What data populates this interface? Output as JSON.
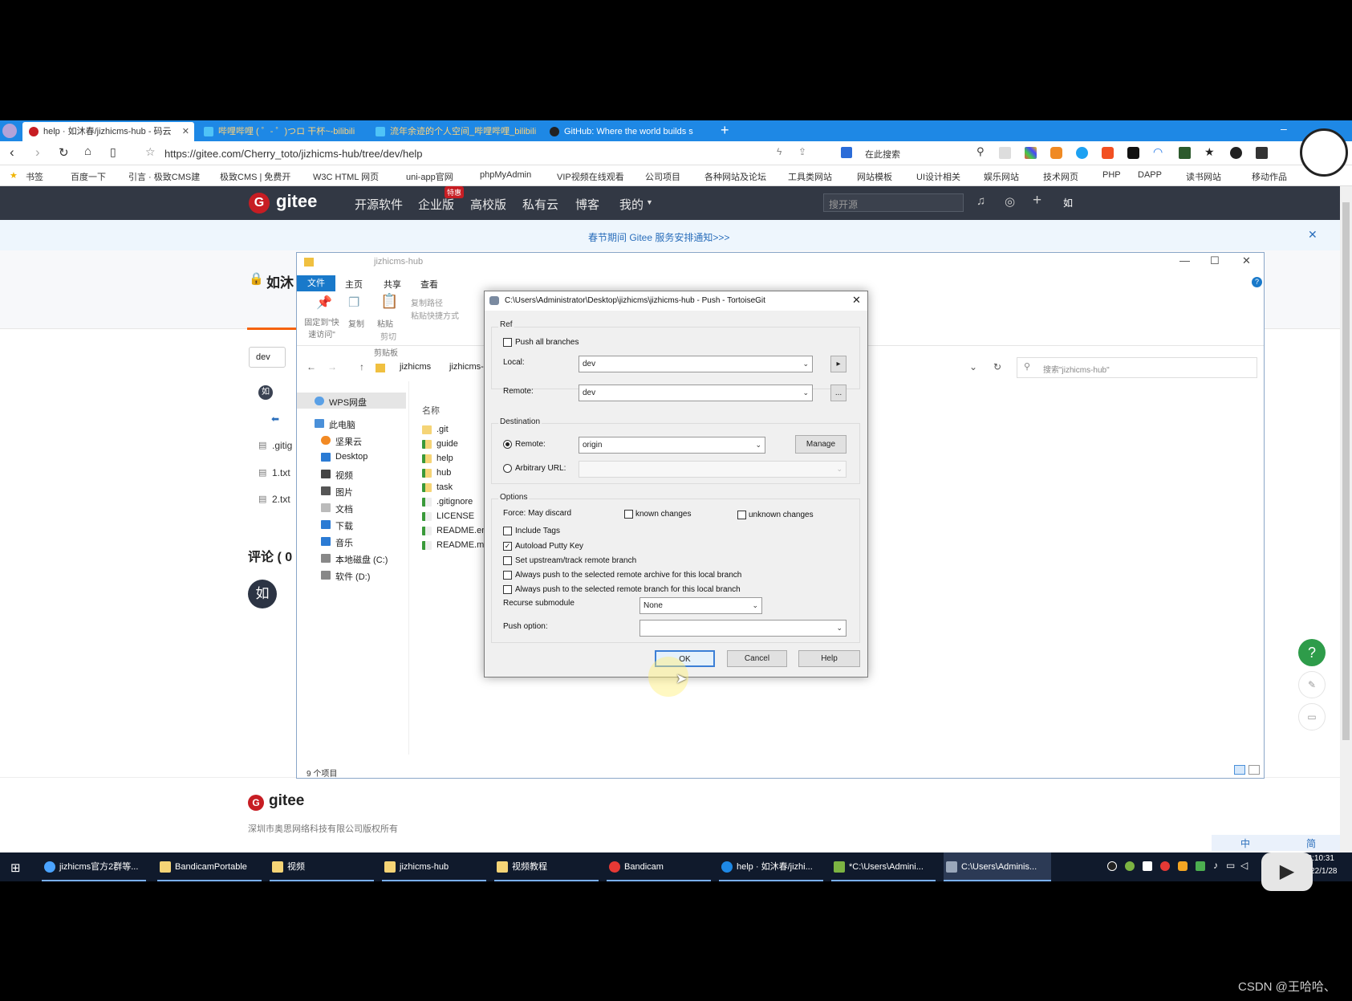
{
  "browser": {
    "tabs": [
      {
        "label": "help · 如沐春/jizhicms-hub - 码云",
        "active": true
      },
      {
        "label": "哔哩哔哩 ( ゜- ゜)つロ 干杯~-bilibili",
        "active": false
      },
      {
        "label": "流年余迹的个人空间_哔哩哔哩_bilibili",
        "active": false
      },
      {
        "label": "GitHub: Where the world builds s",
        "active": false
      }
    ],
    "url": "https://gitee.com/Cherry_toto/jizhicms-hub/tree/dev/help",
    "search_placeholder": "在此搜索",
    "bookmarks": [
      "书签",
      "百度一下",
      "引言 · 极致CMS建",
      "极致CMS | 免费开",
      "W3C HTML 网页",
      "uni-app官网",
      "phpMyAdmin",
      "VIP视频在线观看",
      "公司项目",
      "各种网站及论坛",
      "工具类网站",
      "网站模板",
      "UI设计相关",
      "娱乐网站",
      "技术网页",
      "PHP",
      "DAPP",
      "读书网站",
      "移动作品"
    ]
  },
  "gitee": {
    "logo": "gitee",
    "nav": [
      "开源软件",
      "企业版",
      "高校版",
      "私有云",
      "博客",
      "我的"
    ],
    "enterprise_badge": "特惠",
    "search_placeholder": "搜开源",
    "notice": "春节期间 Gitee 服务安排通知>>>",
    "repo_title": "如沐",
    "branch": "dev",
    "files": [
      ".gitig",
      "1.txt",
      "2.txt"
    ],
    "comments_label": "评论 ( 0",
    "avatar_text": "如",
    "footer_logo": "gitee",
    "footer_text": "深圳市奥思网络科技有限公司版权所有"
  },
  "explorer": {
    "title": "jizhicms-hub",
    "ribbon_tabs": [
      "文件",
      "主页",
      "共享",
      "查看"
    ],
    "ribbon_buttons": [
      "固定到\"快速访问\"",
      "复制",
      "粘贴",
      "复制路径",
      "粘贴快捷方式",
      "剪切",
      "剪贴板"
    ],
    "breadcrumb": [
      "jizhicms",
      "jizhicms-"
    ],
    "search_placeholder": "搜索\"jizhicms-hub\"",
    "nav_items": [
      "WPS网盘",
      "此电脑",
      "坚果云",
      "Desktop",
      "视频",
      "图片",
      "文档",
      "下载",
      "音乐",
      "本地磁盘 (C:)",
      "软件 (D:)"
    ],
    "column_header": "名称",
    "files": [
      ".git",
      "guide",
      "help",
      "hub",
      "task",
      ".gitignore",
      "LICENSE",
      "README.en",
      "README.md"
    ],
    "status": "9 个项目"
  },
  "dialog": {
    "title": "C:\\Users\\Administrator\\Desktop\\jizhicms\\jizhicms-hub - Push - TortoiseGit",
    "ref_group": "Ref",
    "push_all_branches": "Push all branches",
    "local_label": "Local:",
    "local_value": "dev",
    "remote_label": "Remote:",
    "remote_value": "dev",
    "remote_browse": "...",
    "destination_group": "Destination",
    "dest_remote_label": "Remote:",
    "dest_remote_value": "origin",
    "manage_label": "Manage",
    "arbitrary_url_label": "Arbitrary URL:",
    "options_group": "Options",
    "force_label": "Force: May discard",
    "known_changes": "known changes",
    "unknown_changes": "unknown changes",
    "include_tags": "Include Tags",
    "autoload_putty": "Autoload Putty Key",
    "set_upstream": "Set upstream/track remote branch",
    "always_archive": "Always push to the selected remote archive for this local branch",
    "always_branch": "Always push to the selected remote branch for this local branch",
    "recurse_label": "Recurse submodule",
    "recurse_value": "None",
    "push_option_label": "Push option:",
    "push_option_value": "",
    "ok_label": "OK",
    "cancel_label": "Cancel",
    "help_label": "Help"
  },
  "taskbar": {
    "items": [
      "jizhicms官方2群等...",
      "BandicamPortable",
      "视频",
      "jizhicms-hub",
      "视频教程",
      "Bandicam",
      "help · 如沐春/jizhi...",
      "*C:\\Users\\Admini...",
      "C:\\Users\\Adminis..."
    ],
    "time": "13:10:31",
    "date": "2022/1/28",
    "ime": [
      "中",
      "简"
    ]
  },
  "watermark": "CSDN @王哈哈、",
  "colors": {
    "tabbar": "#1e88e5",
    "gitee_nav": "#323844",
    "gitee_red": "#c71d23",
    "help_fab": "#2e9c4a",
    "taskbar": "#101a2c"
  }
}
